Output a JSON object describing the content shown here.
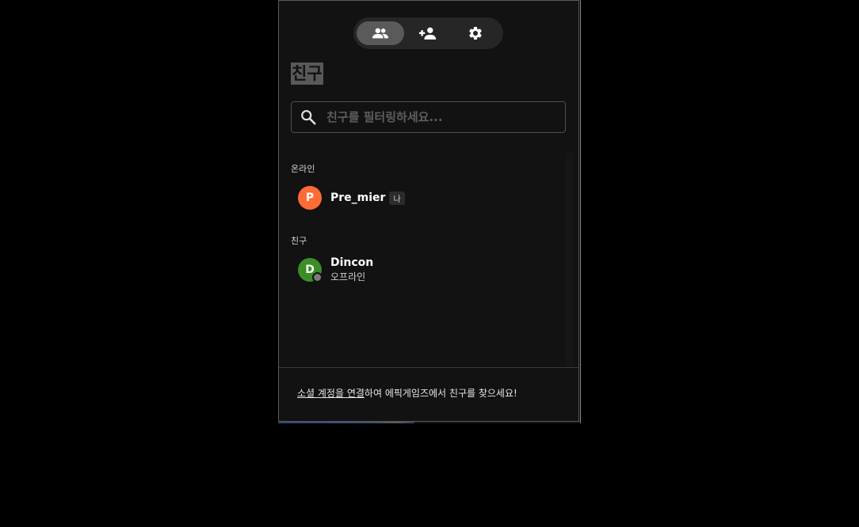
{
  "colors": {
    "background": "#000000",
    "panel": "#121212",
    "tab_active": "#5a5a5a",
    "avatar_premier": "#ff6b35",
    "avatar_dincon": "#3a8d27",
    "offline_dot": "#7b7b7b"
  },
  "tabs": [
    {
      "icon": "friends-icon",
      "active": true
    },
    {
      "icon": "add-friend-icon",
      "active": false
    },
    {
      "icon": "gear-icon",
      "active": false
    }
  ],
  "header": {
    "title": "친구"
  },
  "search": {
    "placeholder": "친구를 필터링하세요...",
    "value": "",
    "icon": "search-icon"
  },
  "sections": {
    "online": {
      "label": "온라인",
      "friends": [
        {
          "initial": "P",
          "name": "Pre_mier",
          "badge": "나"
        }
      ]
    },
    "friends": {
      "label": "친구",
      "friends": [
        {
          "initial": "D",
          "name": "Dincon",
          "status": "오프라인"
        }
      ]
    }
  },
  "footer": {
    "link_text": "소셜 계정을 연결",
    "rest_text": "하여 에픽게임즈에서 친구를 찾으세요!"
  }
}
